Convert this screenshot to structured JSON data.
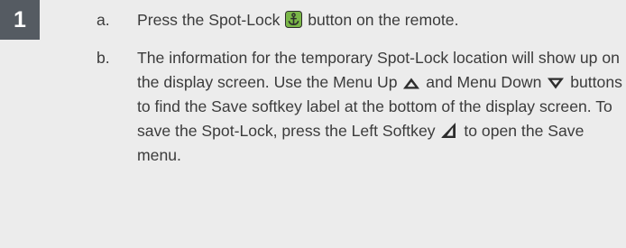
{
  "step": {
    "number": "1"
  },
  "items": [
    {
      "letter": "a.",
      "text_1": "Press the Spot-Lock",
      "text_2": "button on the remote.",
      "icons": [
        "spot-lock-anchor-icon"
      ]
    },
    {
      "letter": "b.",
      "text_1": "The information for the temporary Spot-Lock location will show up on the display screen. Use the Menu Up",
      "text_2": "and Menu Down",
      "text_3": "buttons to find the Save softkey label at the bottom of the display screen. To save the Spot-Lock, press the Left Softkey",
      "text_4": "to open the Save menu.",
      "icons": [
        "menu-up-icon",
        "menu-down-icon",
        "left-softkey-icon"
      ]
    }
  ],
  "colors": {
    "background": "#ececec",
    "badge": "#555b62",
    "text": "#3b3b3b",
    "icon_green": "#7ab648",
    "icon_dark": "#2d2d2d"
  }
}
